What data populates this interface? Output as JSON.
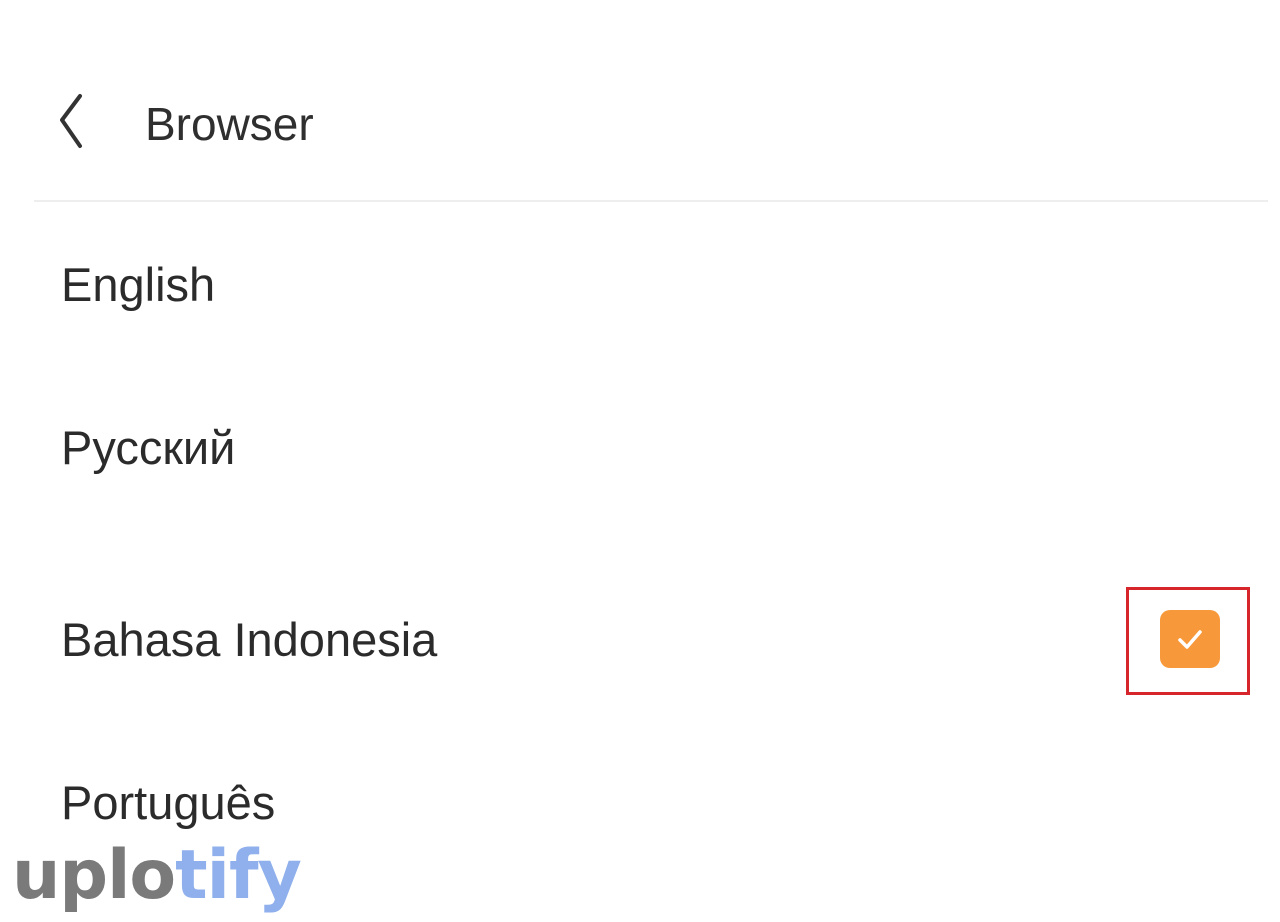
{
  "header": {
    "title": "Browser",
    "back_icon": "chevron-left-icon"
  },
  "languages": [
    {
      "label": "English",
      "selected": false
    },
    {
      "label": "Русский",
      "selected": false
    },
    {
      "label": "Bahasa Indonesia",
      "selected": true
    },
    {
      "label": "Português",
      "selected": false
    }
  ],
  "selection_indicator": {
    "icon": "checkmark-icon",
    "color": "#f7993a",
    "highlight_color": "#d6262c"
  },
  "watermark": {
    "part1": "uplo",
    "part2": "tify",
    "color1": "#7a7a7a",
    "color2": "#8fb0ec"
  }
}
